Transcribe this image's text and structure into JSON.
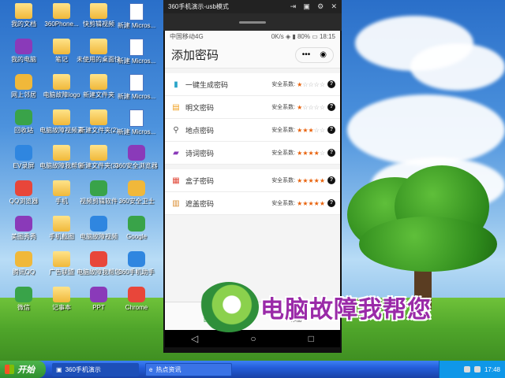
{
  "desktop_icons": [
    {
      "label": "我的文档",
      "kind": "folder"
    },
    {
      "label": "360Phone...",
      "kind": "folder"
    },
    {
      "label": "快剪辑视频",
      "kind": "folder"
    },
    {
      "label": "新建 Micros...",
      "kind": "doc"
    },
    {
      "label": "我的电脑",
      "kind": "app"
    },
    {
      "label": "笔记",
      "kind": "folder"
    },
    {
      "label": "未使用的桌面快捷方式",
      "kind": "folder"
    },
    {
      "label": "新建 Micros...",
      "kind": "doc"
    },
    {
      "label": "网上邻居",
      "kind": "app"
    },
    {
      "label": "电脑故障logo",
      "kind": "folder"
    },
    {
      "label": "新建文件夹",
      "kind": "folder"
    },
    {
      "label": "新建 Micros...",
      "kind": "doc"
    },
    {
      "label": "回收站",
      "kind": "app"
    },
    {
      "label": "电脑故障视频素材",
      "kind": "folder"
    },
    {
      "label": "新建文件夹(2)",
      "kind": "folder"
    },
    {
      "label": "新建 Micros...",
      "kind": "doc"
    },
    {
      "label": "EV录屏",
      "kind": "app"
    },
    {
      "label": "电脑故障我帮您",
      "kind": "folder"
    },
    {
      "label": "新建文件夹(3)",
      "kind": "folder"
    },
    {
      "label": "360安全浏览器",
      "kind": "app"
    },
    {
      "label": "QQ浏览器",
      "kind": "app"
    },
    {
      "label": "手机",
      "kind": "folder"
    },
    {
      "label": "视频剪辑软件",
      "kind": "app"
    },
    {
      "label": "360安全卫士",
      "kind": "app"
    },
    {
      "label": "美图秀秀",
      "kind": "app"
    },
    {
      "label": "手机截图",
      "kind": "folder"
    },
    {
      "label": "电脑故障视频",
      "kind": "app"
    },
    {
      "label": "Google",
      "kind": "app"
    },
    {
      "label": "腾讯QQ",
      "kind": "app"
    },
    {
      "label": "广告联盟",
      "kind": "folder"
    },
    {
      "label": "电脑故障我帮您",
      "kind": "app"
    },
    {
      "label": "360手机助手",
      "kind": "app"
    },
    {
      "label": "微信",
      "kind": "app"
    },
    {
      "label": "记事本",
      "kind": "folder"
    },
    {
      "label": "PPT",
      "kind": "app"
    },
    {
      "label": "Chrome",
      "kind": "app"
    }
  ],
  "phone_window": {
    "title": "360手机演示-usb模式",
    "controls": [
      "⇥",
      "▣",
      "⚙",
      "✕"
    ]
  },
  "status_bar": {
    "carrier": "中国移动4G",
    "right": "0K/s ◈ ▮ 80% ▭ 18:15"
  },
  "app": {
    "title": "添加密码",
    "capsule_more": "•••",
    "capsule_close": "◉",
    "security_label": "安全系数:",
    "help": "?",
    "groups": [
      {
        "rows": [
          {
            "label": "一键生成密码",
            "icon": "cup-icon",
            "glyph": "▮",
            "color": "#2ba5c9",
            "rating": 1,
            "max": 5
          },
          {
            "label": "明文密码",
            "icon": "note-icon",
            "glyph": "▤",
            "color": "#f0a020",
            "rating": 1,
            "max": 5
          },
          {
            "label": "地点密码",
            "icon": "pin-icon",
            "glyph": "⚲",
            "color": "#555555",
            "rating": 3,
            "max": 5
          },
          {
            "label": "诗词密码",
            "icon": "book-icon",
            "glyph": "▰",
            "color": "#8a3ab9",
            "rating": 4,
            "max": 5
          }
        ]
      },
      {
        "rows": [
          {
            "label": "盒子密码",
            "icon": "grid-icon",
            "glyph": "▦",
            "color": "#e14b3b",
            "rating": 5,
            "max": 5
          },
          {
            "label": "遮盖密码",
            "icon": "cover-icon",
            "glyph": "▥",
            "color": "#d98a2a",
            "rating": 5,
            "max": 5
          }
        ]
      }
    ],
    "tabs": [
      {
        "label": "首页",
        "glyph": "⌂"
      },
      {
        "label": "添加",
        "glyph": "+"
      }
    ]
  },
  "nav_buttons": [
    "◁",
    "○",
    "□"
  ],
  "watermark": "电脑故障我帮您",
  "taskbar": {
    "start": "开始",
    "tasks": [
      "360手机演示",
      "热点资讯"
    ],
    "clock": "17:48"
  },
  "colors": {
    "accent": "#39a349",
    "star_on": "#e8620c",
    "watermark": "#9a2aa8"
  }
}
